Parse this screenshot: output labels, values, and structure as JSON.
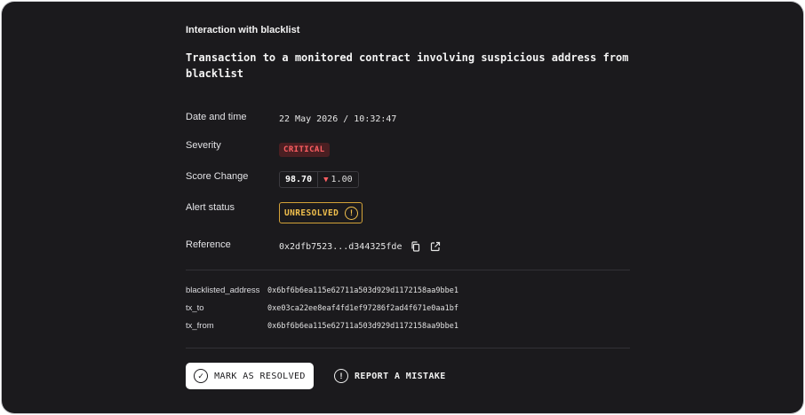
{
  "alert": {
    "category": "Interaction with blacklist",
    "title": "Transaction to a monitored contract involving suspicious address from blacklist"
  },
  "fields": {
    "date_label": "Date and time",
    "date_value": "22 May 2026 / 10:32:47",
    "severity_label": "Severity",
    "severity_value": "CRITICAL",
    "score_label": "Score Change",
    "score_value": "98.70",
    "score_delta": "1.00",
    "status_label": "Alert status",
    "status_value": "UNRESOLVED",
    "reference_label": "Reference",
    "reference_value": "0x2dfb7523...d344325fde"
  },
  "details": [
    {
      "key": "blacklisted_address",
      "value": "0x6bf6b6ea115e62711a503d929d1172158aa9bbe1"
    },
    {
      "key": "tx_to",
      "value": "0xe03ca22ee8eaf4fd1ef97286f2ad4f671e0aa1bf"
    },
    {
      "key": "tx_from",
      "value": "0x6bf6b6ea115e62711a503d929d1172158aa9bbe1"
    }
  ],
  "actions": {
    "resolve_label": "MARK AS RESOLVED",
    "report_label": "REPORT A MISTAKE"
  },
  "colors": {
    "background": "#1b1a1d",
    "critical": "#ff5f63",
    "warning": "#f0bf4d"
  },
  "icons": {
    "status": "exclamation-circle-icon",
    "copy": "copy-icon",
    "external": "external-link-icon",
    "resolve": "check-circle-icon",
    "report": "alert-circle-icon",
    "delta": "triangle-down-icon"
  }
}
